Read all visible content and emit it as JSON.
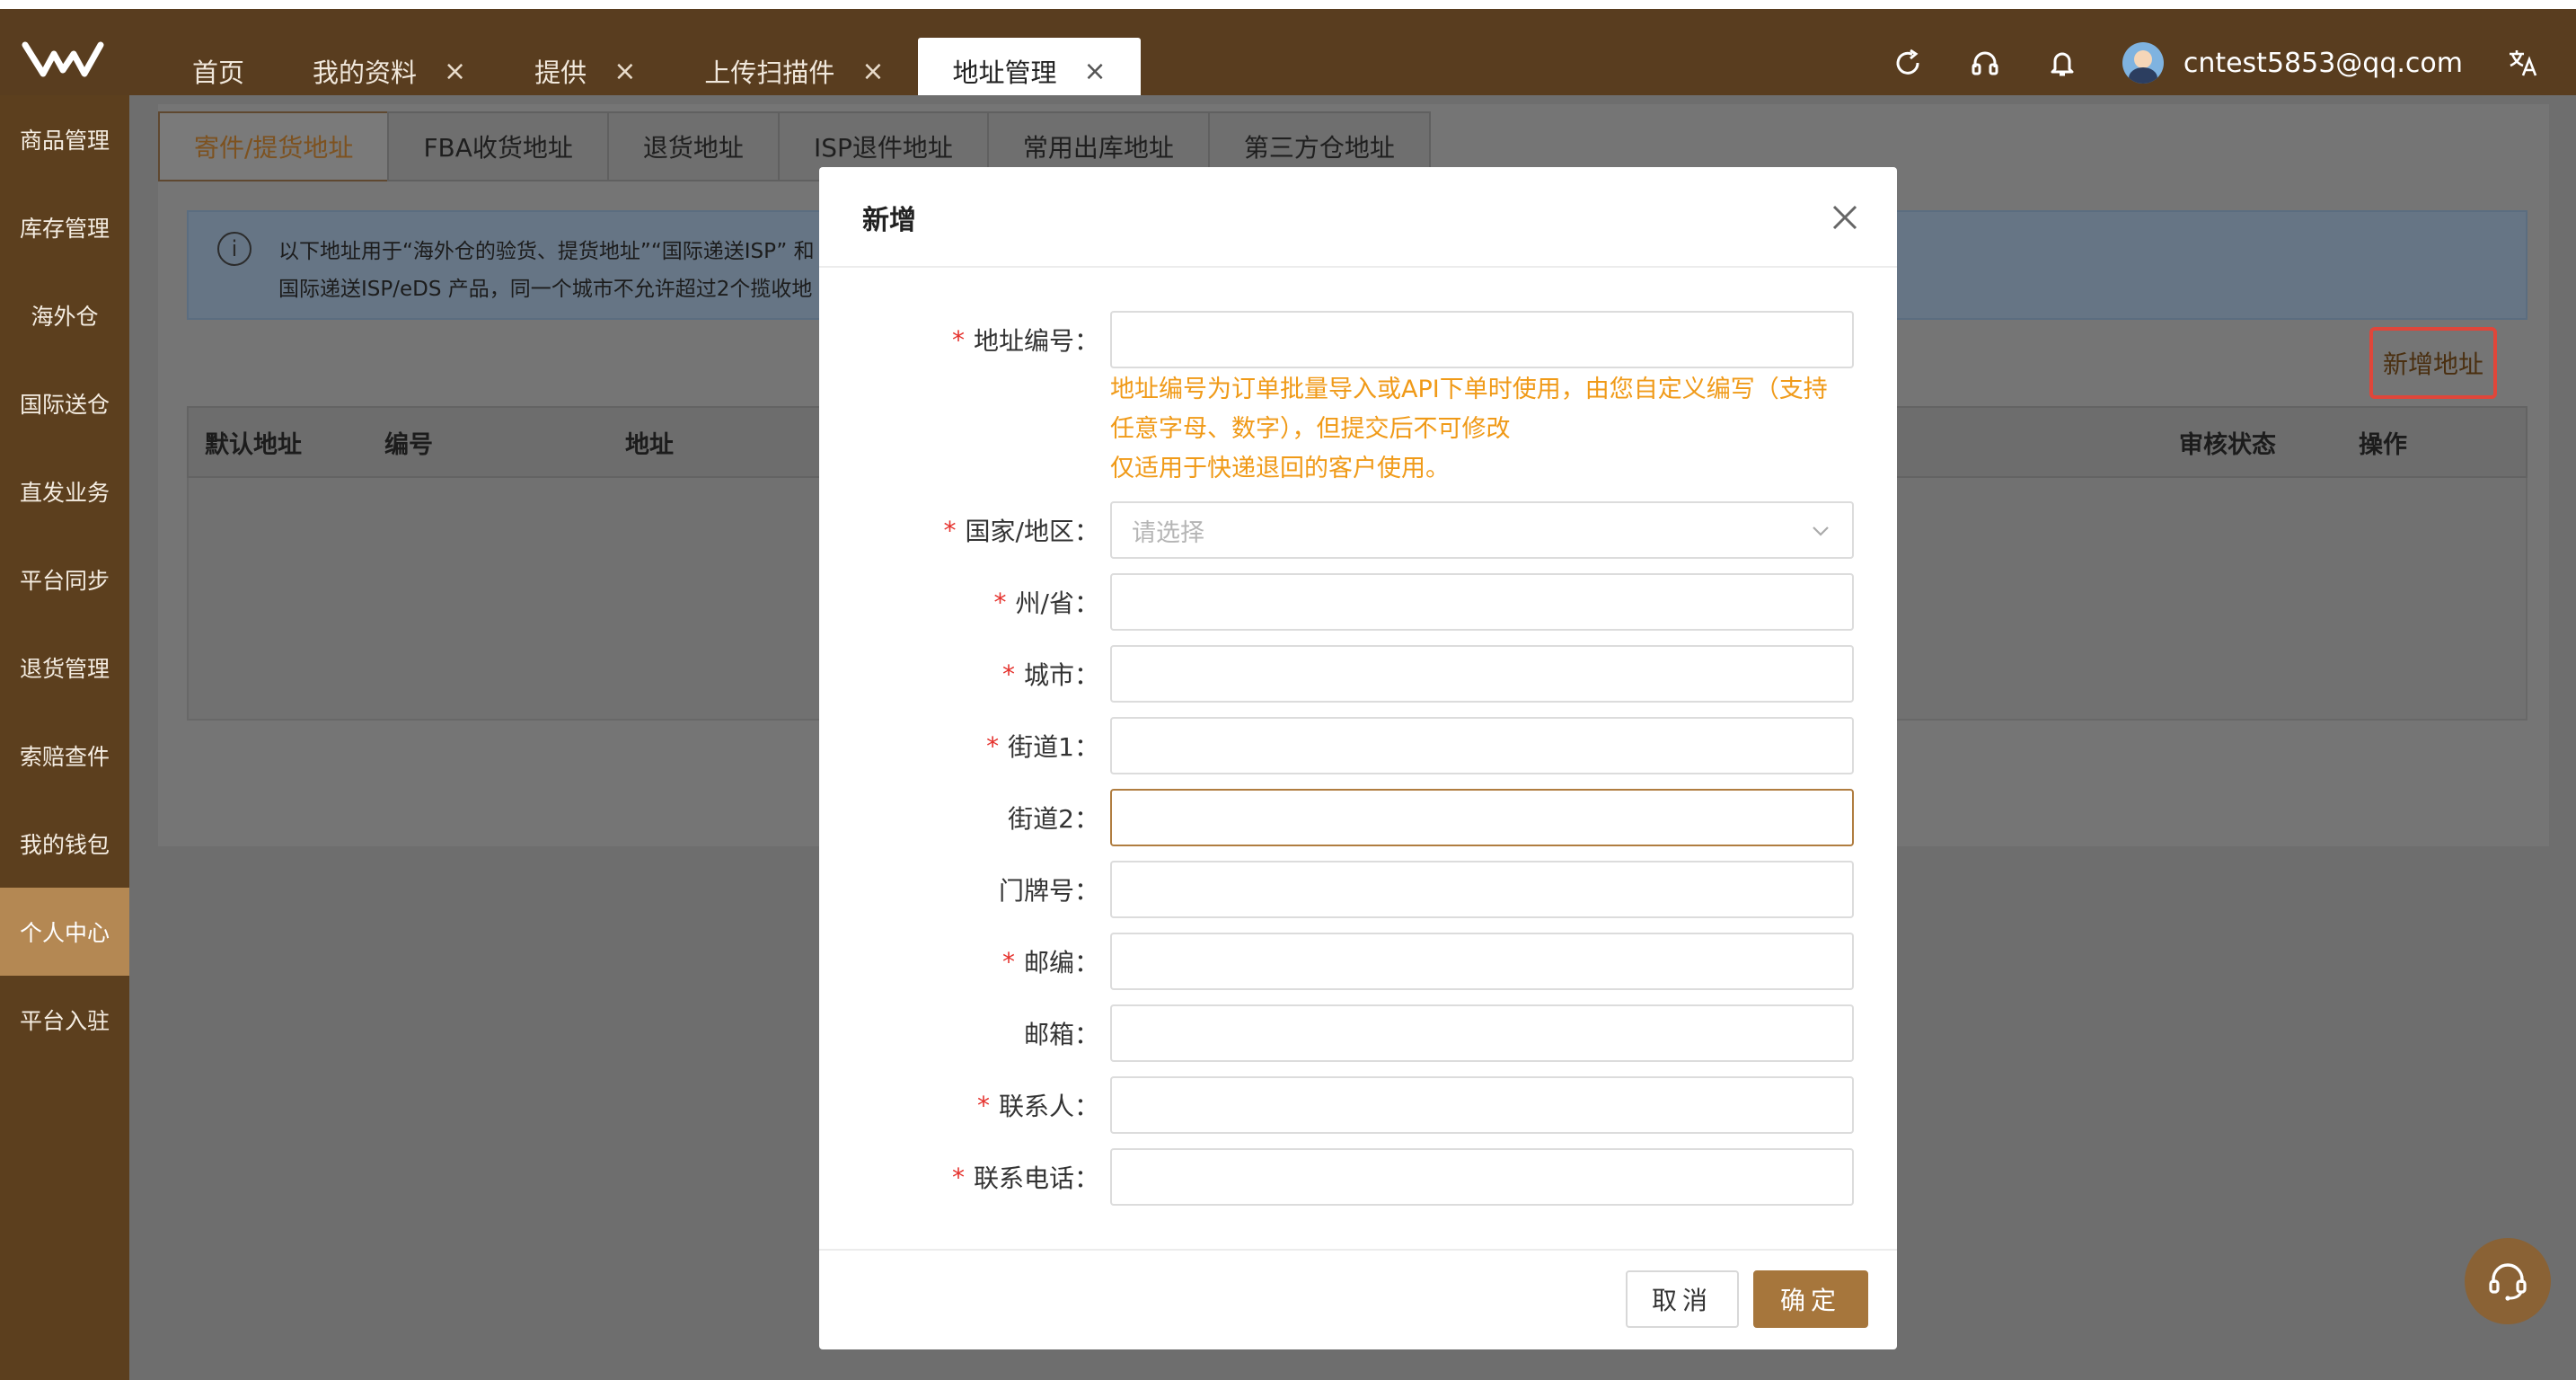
{
  "header": {
    "tabs": [
      {
        "label": "首页",
        "closable": false,
        "active": false
      },
      {
        "label": "我的资料",
        "closable": true,
        "active": false
      },
      {
        "label": "提供",
        "closable": true,
        "active": false
      },
      {
        "label": "上传扫描件",
        "closable": true,
        "active": false
      },
      {
        "label": "地址管理",
        "closable": true,
        "active": true
      }
    ],
    "close_glyph": "×",
    "user_email": "cntest5853@qq.com",
    "icons": [
      "refresh-icon",
      "headset-icon",
      "bell-icon",
      "translate-icon"
    ]
  },
  "sidebar": {
    "items": [
      {
        "label": "商品管理"
      },
      {
        "label": "库存管理"
      },
      {
        "label": "海外仓"
      },
      {
        "label": "国际送仓"
      },
      {
        "label": "直发业务"
      },
      {
        "label": "平台同步"
      },
      {
        "label": "退货管理"
      },
      {
        "label": "索赔查件"
      },
      {
        "label": "我的钱包"
      },
      {
        "label": "个人中心",
        "active": true
      },
      {
        "label": "平台入驻"
      }
    ]
  },
  "main": {
    "subtabs": [
      "寄件/提货地址",
      "FBA收货地址",
      "退货地址",
      "ISP退件地址",
      "常用出库地址",
      "第三方仓地址"
    ],
    "active_subtab": 0,
    "notice": {
      "line1": "以下地址用于“海外仓的验货、提货地址”“国际递送ISP” 和",
      "line2": "国际递送ISP/eDS 产品，同一个城市不允许超过2个揽收地"
    },
    "add_address_label": "新增地址",
    "table_headers": {
      "default": "默认地址",
      "number": "编号",
      "address": "地址",
      "review_status": "审核状态",
      "action": "操作"
    }
  },
  "modal": {
    "title": "新增",
    "hint_line1": "地址编号为订单批量导入或API下单时使用，由您自定义编写（支持",
    "hint_line2": "任意字母、数字），但提交后不可修改",
    "hint_line3": "仅适用于快递退回的客户使用。",
    "fields": [
      {
        "label": "地址编号",
        "required": true,
        "value": ""
      },
      {
        "label": "国家/地区",
        "required": true,
        "placeholder": "请选择",
        "type": "select"
      },
      {
        "label": "州/省",
        "required": true,
        "value": ""
      },
      {
        "label": "城市",
        "required": true,
        "value": ""
      },
      {
        "label": "街道1",
        "required": true,
        "value": ""
      },
      {
        "label": "街道2",
        "required": false,
        "value": "",
        "focused": true
      },
      {
        "label": "门牌号",
        "required": false,
        "value": ""
      },
      {
        "label": "邮编",
        "required": true,
        "value": ""
      },
      {
        "label": "邮箱",
        "required": false,
        "value": ""
      },
      {
        "label": "联系人",
        "required": true,
        "value": ""
      },
      {
        "label": "联系电话",
        "required": true,
        "value": ""
      }
    ],
    "colon": "：",
    "required_mark": "*",
    "cancel_label": "取消",
    "confirm_label": "确定"
  },
  "colors": {
    "header_bg": "#593d1f",
    "sidebar_active": "#b48853",
    "accent": "#a6763c",
    "hint": "#f09a18",
    "required": "#e5322d",
    "highlight_box": "#e0463a"
  }
}
